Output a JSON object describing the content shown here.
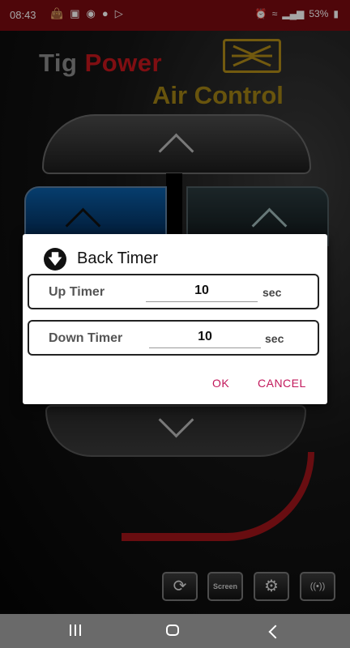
{
  "status_bar": {
    "time": "08:43",
    "battery": "53%",
    "left_icons": [
      "bag-icon",
      "image-icon",
      "assistant-icon",
      "globe-icon",
      "play-store-icon"
    ],
    "right_icons": [
      "alarm-icon",
      "wifi-icon",
      "signal-icon",
      "battery-icon"
    ]
  },
  "app": {
    "logo_line1_a": "Tig",
    "logo_line1_b": "Power",
    "logo_line2": "Air Control",
    "colors": {
      "logo_red": "#c3161d",
      "logo_gold": "#a08214",
      "pad_blue": "#0a5ea8"
    },
    "tools": [
      {
        "name": "refresh-icon",
        "label": "⟳"
      },
      {
        "name": "screen",
        "label": "Screen"
      },
      {
        "name": "gear-icon",
        "label": "⚙"
      },
      {
        "name": "wifi-icon",
        "label": "((•))"
      }
    ]
  },
  "dialog": {
    "title": "Back Timer",
    "icon": "download-arrow-icon",
    "up_timer": {
      "label": "Up Timer",
      "value": "10",
      "unit": "sec"
    },
    "down_timer": {
      "label": "Down Timer",
      "value": "10",
      "unit": "sec"
    },
    "ok_label": "OK",
    "cancel_label": "CANCEL",
    "accent": "#c2185b"
  },
  "nav_bar": {
    "buttons": [
      "recents-icon",
      "home-icon",
      "back-icon"
    ]
  }
}
